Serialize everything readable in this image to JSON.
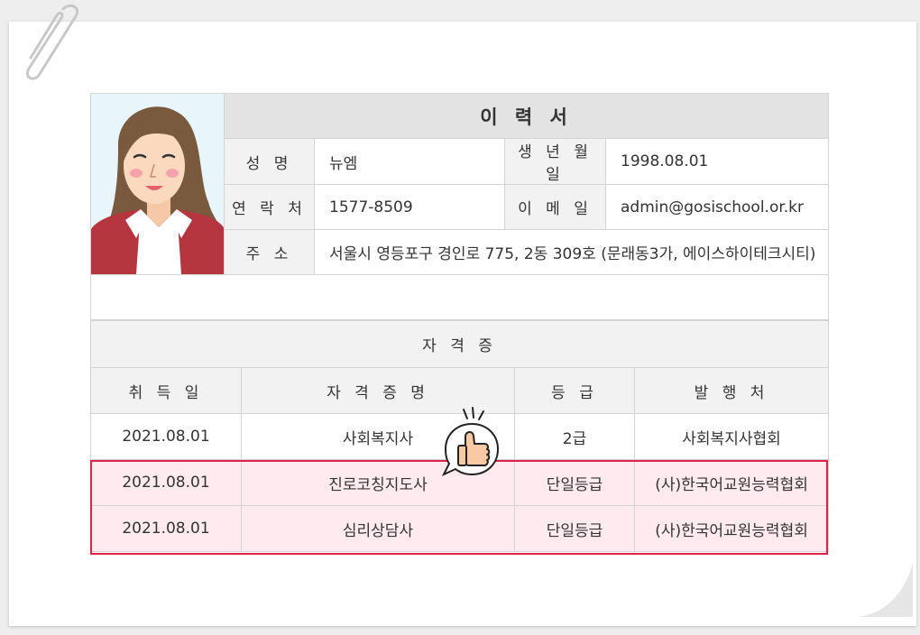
{
  "resume": {
    "title": "이 력 서",
    "name_label": "성 명",
    "name": "뉴엠",
    "birth_label": "생 년 월 일",
    "birth": "1998.08.01",
    "phone_label": "연 락 처",
    "phone": "1577-8509",
    "email_label": "이 메 일",
    "email": "admin@gosischool.or.kr",
    "address_label": "주 소",
    "address": "서울시 영등포구 경인로 775, 2동 309호 (문래동3가, 에이스하이테크시티)"
  },
  "certificates": {
    "caption": "자 격 증",
    "headers": [
      "취 득 일",
      "자 격 증 명",
      "등 급",
      "발 행 처"
    ],
    "rows": [
      [
        "2021.08.01",
        "사회복지사",
        "2급",
        "사회복지사협회"
      ],
      [
        "2021.08.01",
        "진로코칭지도사",
        "단일등급",
        "(사)한국어교원능력협회"
      ],
      [
        "2021.08.01",
        "심리상담사",
        "단일등급",
        "(사)한국어교원능력협회"
      ]
    ]
  },
  "colors": {
    "highlight_border": "#e0224a",
    "highlight_fill": "#ffeaf0",
    "header_fill": "#f2f2f2"
  }
}
